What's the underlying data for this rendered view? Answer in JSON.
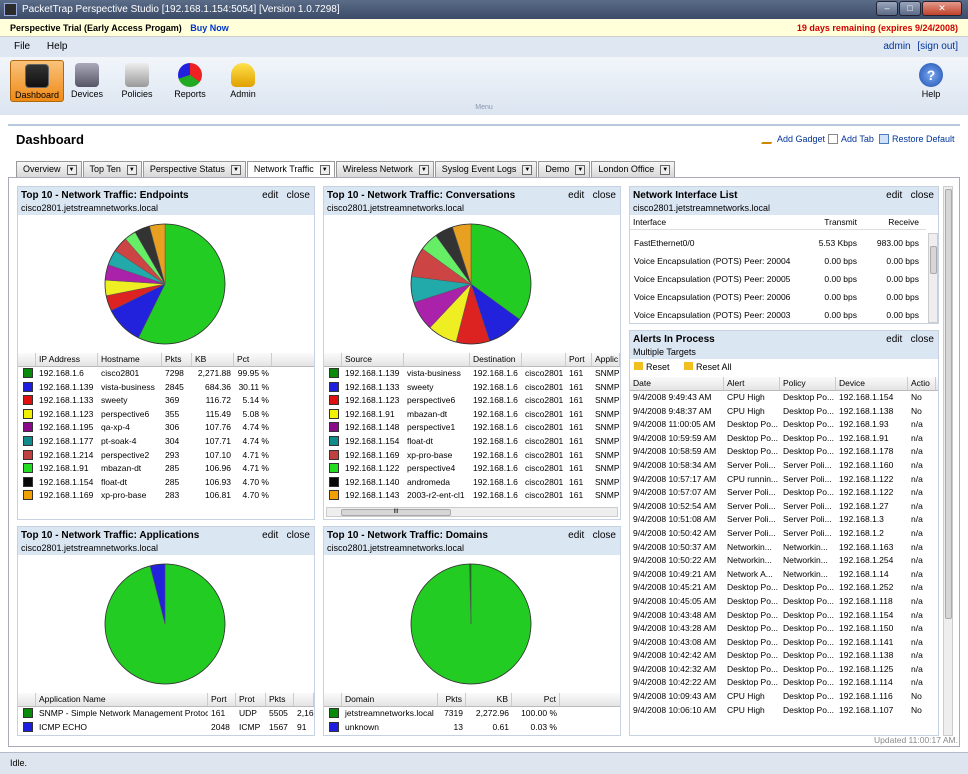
{
  "window": {
    "title": "PacketTrap Perspective Studio [192.168.1.154:5054] [Version 1.0.7298]"
  },
  "trial": {
    "label": "Perspective Trial (Early Access Progam)",
    "buy": "Buy Now",
    "remaining": "19 days remaining (expires 9/24/2008)"
  },
  "menu": {
    "file": "File",
    "help": "Help",
    "user": "admin",
    "signout": "[sign out]",
    "label": "Menu"
  },
  "toolbar": {
    "dashboard": "Dashboard",
    "devices": "Devices",
    "policies": "Policies",
    "reports": "Reports",
    "admin": "Admin",
    "help": "Help"
  },
  "dashboard": {
    "title": "Dashboard",
    "add_gadget": "Add Gadget",
    "add_tab": "Add Tab",
    "restore": "Restore Default"
  },
  "tabs": [
    "Overview",
    "Top Ten",
    "Perspective Status",
    "Network Traffic",
    "Wireless Network",
    "Syslog  Event Logs",
    "Demo",
    "London Office"
  ],
  "common": {
    "edit": "edit",
    "close": "close",
    "host": "cisco2801.jetstreamnetworks.local"
  },
  "endpoints": {
    "title": "Top 10 - Network Traffic: Endpoints",
    "headers": [
      "IP Address",
      "Hostname",
      "Pkts",
      "KB",
      "Pct"
    ],
    "rows": [
      {
        "color": "#0a8a0a",
        "ip": "192.168.1.6",
        "host": "cisco2801",
        "pkts": "7298",
        "kb": "2,271.88",
        "pct": "99.95 %"
      },
      {
        "color": "#1e1ee0",
        "ip": "192.168.1.139",
        "host": "vista-business",
        "pkts": "2845",
        "kb": "684.36",
        "pct": "30.11 %"
      },
      {
        "color": "#e01010",
        "ip": "192.168.1.133",
        "host": "sweety",
        "pkts": "369",
        "kb": "116.72",
        "pct": "5.14 %"
      },
      {
        "color": "#f0f000",
        "ip": "192.168.1.123",
        "host": "perspective6",
        "pkts": "355",
        "kb": "115.49",
        "pct": "5.08 %"
      },
      {
        "color": "#8a0a8a",
        "ip": "192.168.1.195",
        "host": "qa-xp-4",
        "pkts": "306",
        "kb": "107.76",
        "pct": "4.74 %"
      },
      {
        "color": "#108a8a",
        "ip": "192.168.1.177",
        "host": "pt-soak-4",
        "pkts": "304",
        "kb": "107.71",
        "pct": "4.74 %"
      },
      {
        "color": "#c04040",
        "ip": "192.168.1.214",
        "host": "perspective2",
        "pkts": "293",
        "kb": "107.10",
        "pct": "4.71 %"
      },
      {
        "color": "#22dd22",
        "ip": "192.168.1.91",
        "host": "mbazan-dt",
        "pkts": "285",
        "kb": "106.96",
        "pct": "4.71 %"
      },
      {
        "color": "#080808",
        "ip": "192.168.1.154",
        "host": "float-dt",
        "pkts": "285",
        "kb": "106.93",
        "pct": "4.70 %"
      },
      {
        "color": "#f0a000",
        "ip": "192.168.1.169",
        "host": "xp-pro-base",
        "pkts": "283",
        "kb": "106.81",
        "pct": "4.70 %"
      }
    ]
  },
  "conversations": {
    "title": "Top 10 - Network Traffic: Conversations",
    "headers": [
      "Source",
      "",
      "Destination",
      "",
      "Port",
      "Applic"
    ],
    "rows": [
      {
        "color": "#0a8a0a",
        "src": "192.168.1.139",
        "sname": "vista-business",
        "dst": "192.168.1.6",
        "dname": "cisco2801",
        "port": "161",
        "app": "SNMP"
      },
      {
        "color": "#1e1ee0",
        "src": "192.168.1.133",
        "sname": "sweety",
        "dst": "192.168.1.6",
        "dname": "cisco2801",
        "port": "161",
        "app": "SNMP"
      },
      {
        "color": "#e01010",
        "src": "192.168.1.123",
        "sname": "perspective6",
        "dst": "192.168.1.6",
        "dname": "cisco2801",
        "port": "161",
        "app": "SNMP"
      },
      {
        "color": "#f0f000",
        "src": "192.168.1.91",
        "sname": "mbazan-dt",
        "dst": "192.168.1.6",
        "dname": "cisco2801",
        "port": "161",
        "app": "SNMP"
      },
      {
        "color": "#8a0a8a",
        "src": "192.168.1.148",
        "sname": "perspective1",
        "dst": "192.168.1.6",
        "dname": "cisco2801",
        "port": "161",
        "app": "SNMP"
      },
      {
        "color": "#108a8a",
        "src": "192.168.1.154",
        "sname": "float-dt",
        "dst": "192.168.1.6",
        "dname": "cisco2801",
        "port": "161",
        "app": "SNMP"
      },
      {
        "color": "#c04040",
        "src": "192.168.1.169",
        "sname": "xp-pro-base",
        "dst": "192.168.1.6",
        "dname": "cisco2801",
        "port": "161",
        "app": "SNMP"
      },
      {
        "color": "#22dd22",
        "src": "192.168.1.122",
        "sname": "perspective4",
        "dst": "192.168.1.6",
        "dname": "cisco2801",
        "port": "161",
        "app": "SNMP"
      },
      {
        "color": "#080808",
        "src": "192.168.1.140",
        "sname": "andromeda",
        "dst": "192.168.1.6",
        "dname": "cisco2801",
        "port": "161",
        "app": "SNMP"
      },
      {
        "color": "#f0a000",
        "src": "192.168.1.143",
        "sname": "2003-r2-ent-cl1",
        "dst": "192.168.1.6",
        "dname": "cisco2801",
        "port": "161",
        "app": "SNMP"
      }
    ]
  },
  "applications": {
    "title": "Top 10 - Network Traffic: Applications",
    "headers": [
      "Application Name",
      "Port",
      "Prot",
      "Pkts",
      ""
    ],
    "rows": [
      {
        "color": "#0a8a0a",
        "name": "SNMP - Simple Network Management Protocol",
        "port": "161",
        "prot": "UDP",
        "pkts": "5505",
        "kb": "2,16!"
      },
      {
        "color": "#1e1ee0",
        "name": "ICMP ECHO",
        "port": "2048",
        "prot": "ICMP",
        "pkts": "1567",
        "kb": "91"
      }
    ]
  },
  "domains": {
    "title": "Top 10 - Network Traffic: Domains",
    "headers": [
      "Domain",
      "Pkts",
      "KB",
      "Pct"
    ],
    "rows": [
      {
        "color": "#0a8a0a",
        "name": "jetstreamnetworks.local",
        "pkts": "7319",
        "kb": "2,272.96",
        "pct": "100.00 %"
      },
      {
        "color": "#1e1ee0",
        "name": "unknown",
        "pkts": "13",
        "kb": "0.61",
        "pct": "0.03 %"
      }
    ]
  },
  "interfaces": {
    "title": "Network Interface List",
    "headers": [
      "Interface",
      "Transmit",
      "Receive"
    ],
    "rows": [
      {
        "name": "FastEthernet0/0",
        "tx": "5.53 Kbps",
        "rx": "983.00 bps"
      },
      {
        "name": "Voice Encapsulation (POTS) Peer: 20004",
        "tx": "0.00 bps",
        "rx": "0.00 bps"
      },
      {
        "name": "Voice Encapsulation (POTS) Peer: 20005",
        "tx": "0.00 bps",
        "rx": "0.00 bps"
      },
      {
        "name": "Voice Encapsulation (POTS) Peer: 20006",
        "tx": "0.00 bps",
        "rx": "0.00 bps"
      },
      {
        "name": "Voice Encapsulation (POTS) Peer: 20003",
        "tx": "0.00 bps",
        "rx": "0.00 bps"
      }
    ]
  },
  "alerts": {
    "title": "Alerts In Process",
    "subtitle": "Multiple Targets",
    "reset": "Reset",
    "reset_all": "Reset All",
    "headers": [
      "Date",
      "Alert",
      "Policy",
      "Device",
      "Actio"
    ],
    "rows": [
      [
        "9/4/2008 9:49:43 AM",
        "CPU High",
        "Desktop Po...",
        "192.168.1.154",
        "No"
      ],
      [
        "9/4/2008 9:48:37 AM",
        "CPU High",
        "Desktop Po...",
        "192.168.1.138",
        "No"
      ],
      [
        "9/4/2008 11:00:05 AM",
        "Desktop Po...",
        "Desktop Po...",
        "192.168.1.93",
        "n/a"
      ],
      [
        "9/4/2008 10:59:59 AM",
        "Desktop Po...",
        "Desktop Po...",
        "192.168.1.91",
        "n/a"
      ],
      [
        "9/4/2008 10:58:59 AM",
        "Desktop Po...",
        "Desktop Po...",
        "192.168.1.178",
        "n/a"
      ],
      [
        "9/4/2008 10:58:34 AM",
        "Server Poli...",
        "Server Poli...",
        "192.168.1.160",
        "n/a"
      ],
      [
        "9/4/2008 10:57:17 AM",
        "CPU runnin...",
        "Server Poli...",
        "192.168.1.122",
        "n/a"
      ],
      [
        "9/4/2008 10:57:07 AM",
        "Server Poli...",
        "Desktop Po...",
        "192.168.1.122",
        "n/a"
      ],
      [
        "9/4/2008 10:52:54 AM",
        "Server Poli...",
        "Server Poli...",
        "192.168.1.27",
        "n/a"
      ],
      [
        "9/4/2008 10:51:08 AM",
        "Server Poli...",
        "Server Poli...",
        "192.168.1.3",
        "n/a"
      ],
      [
        "9/4/2008 10:50:42 AM",
        "Server Poli...",
        "Server Poli...",
        "192.168.1.2",
        "n/a"
      ],
      [
        "9/4/2008 10:50:37 AM",
        "Networkin...",
        "Networkin...",
        "192.168.1.163",
        "n/a"
      ],
      [
        "9/4/2008 10:50:22 AM",
        "Networkin...",
        "Networkin...",
        "192.168.1.254",
        "n/a"
      ],
      [
        "9/4/2008 10:49:21 AM",
        "Network A...",
        "Networkin...",
        "192.168.1.14",
        "n/a"
      ],
      [
        "9/4/2008 10:45:21 AM",
        "Desktop Po...",
        "Desktop Po...",
        "192.168.1.252",
        "n/a"
      ],
      [
        "9/4/2008 10:45:05 AM",
        "Desktop Po...",
        "Desktop Po...",
        "192.168.1.118",
        "n/a"
      ],
      [
        "9/4/2008 10:43:48 AM",
        "Desktop Po...",
        "Desktop Po...",
        "192.168.1.154",
        "n/a"
      ],
      [
        "9/4/2008 10:43:28 AM",
        "Desktop Po...",
        "Desktop Po...",
        "192.168.1.150",
        "n/a"
      ],
      [
        "9/4/2008 10:43:08 AM",
        "Desktop Po...",
        "Desktop Po...",
        "192.168.1.141",
        "n/a"
      ],
      [
        "9/4/2008 10:42:42 AM",
        "Desktop Po...",
        "Desktop Po...",
        "192.168.1.138",
        "n/a"
      ],
      [
        "9/4/2008 10:42:32 AM",
        "Desktop Po...",
        "Desktop Po...",
        "192.168.1.125",
        "n/a"
      ],
      [
        "9/4/2008 10:42:22 AM",
        "Desktop Po...",
        "Desktop Po...",
        "192.168.1.114",
        "n/a"
      ],
      [
        "9/4/2008 10:09:43 AM",
        "CPU High",
        "Desktop Po...",
        "192.168.1.116",
        "No"
      ],
      [
        "9/4/2008 10:06:10 AM",
        "CPU High",
        "Desktop Po...",
        "192.168.1.107",
        "No"
      ]
    ]
  },
  "pies": {
    "endpoints": [
      {
        "v": 55,
        "c": "#22cc22"
      },
      {
        "v": 10,
        "c": "#2222dd"
      },
      {
        "v": 4,
        "c": "#dd2222"
      },
      {
        "v": 4,
        "c": "#eeee22"
      },
      {
        "v": 4,
        "c": "#aa22aa"
      },
      {
        "v": 4,
        "c": "#22aaaa"
      },
      {
        "v": 4,
        "c": "#cc4444"
      },
      {
        "v": 3,
        "c": "#66ee66"
      },
      {
        "v": 4,
        "c": "#333333"
      },
      {
        "v": 4,
        "c": "#e8a020"
      }
    ],
    "conversations": [
      {
        "v": 35,
        "c": "#22cc22"
      },
      {
        "v": 10,
        "c": "#2222dd"
      },
      {
        "v": 9,
        "c": "#dd2222"
      },
      {
        "v": 8,
        "c": "#eeee22"
      },
      {
        "v": 8,
        "c": "#aa22aa"
      },
      {
        "v": 7,
        "c": "#22aaaa"
      },
      {
        "v": 8,
        "c": "#cc4444"
      },
      {
        "v": 5,
        "c": "#66ee66"
      },
      {
        "v": 5,
        "c": "#333333"
      },
      {
        "v": 5,
        "c": "#e8a020"
      }
    ],
    "applications": [
      {
        "v": 96,
        "c": "#22cc22"
      },
      {
        "v": 4,
        "c": "#2222dd"
      }
    ],
    "domains": [
      {
        "v": 99.6,
        "c": "#22cc22"
      },
      {
        "v": 0.4,
        "c": "#116611"
      }
    ]
  },
  "updated": "Updated 11:00:17 AM.",
  "status": "Idle."
}
